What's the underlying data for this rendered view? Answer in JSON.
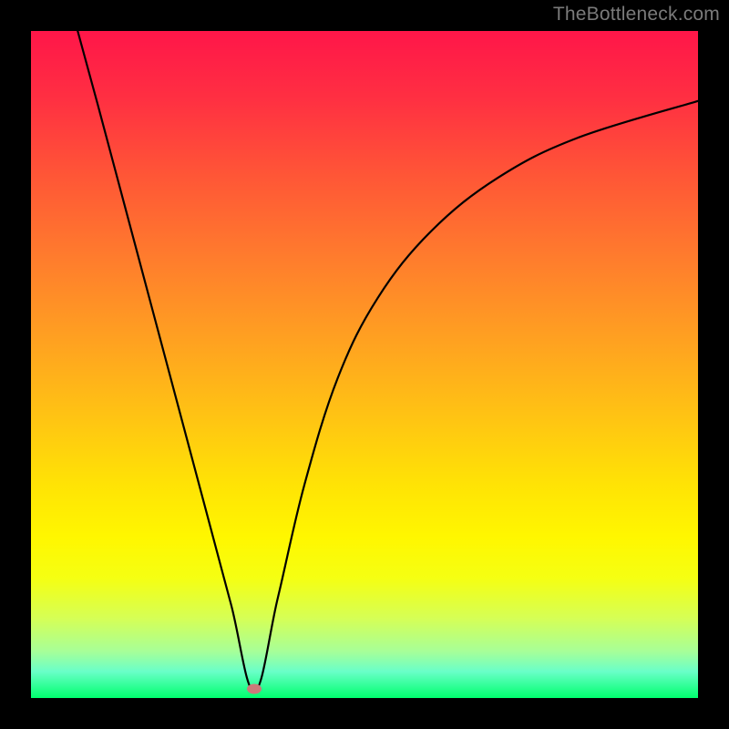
{
  "watermark": "TheBottleneck.com",
  "colors": {
    "frame": "#000000",
    "curve": "#000000",
    "marker": "#cc7a7a",
    "gradient_top": "#ff1649",
    "gradient_bottom": "#00ff6e",
    "watermark_text": "#7a7a7a"
  },
  "chart_data": {
    "type": "line",
    "title": "",
    "xlabel": "",
    "ylabel": "",
    "xlim": [
      0,
      100
    ],
    "ylim": [
      0,
      100
    ],
    "grid": false,
    "legend": false,
    "annotations": [],
    "marker": {
      "x": 33.5,
      "y": 1.4
    },
    "series": [
      {
        "name": "bottleneck-curve",
        "x": [
          7,
          10,
          14,
          18,
          22,
          26,
          30,
          33.5,
          37,
          41,
          46,
          52,
          60,
          70,
          82,
          100
        ],
        "y": [
          100,
          89,
          74,
          59,
          44,
          29,
          14,
          1,
          15,
          32,
          48,
          60,
          70,
          78,
          84,
          89.5
        ]
      }
    ]
  }
}
